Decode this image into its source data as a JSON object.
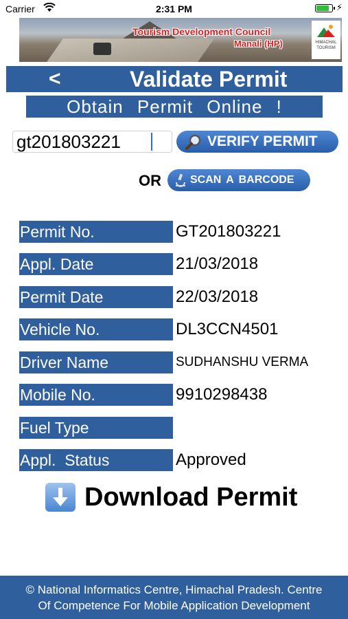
{
  "status_bar": {
    "carrier": "Carrier",
    "time": "2:31 PM",
    "battery_level": 0.85
  },
  "banner": {
    "title_line1": "Tourism Development Council",
    "title_line2": "Manali (HP)",
    "logo_text": "HIMACHAL TOURISM"
  },
  "header": {
    "back_label": "<",
    "title": "Validate Permit"
  },
  "subheader": "Obtain Permit Online !",
  "search": {
    "permit_value": "gt201803221",
    "verify_label": "VERIFY PERMIT",
    "or_label": "OR",
    "scan_label": "SCAN A BARCODE"
  },
  "details": {
    "permit_no": {
      "label": "Permit No.",
      "value": "GT201803221"
    },
    "appl_date": {
      "label": "Appl. Date",
      "value": "21/03/2018"
    },
    "permit_date": {
      "label": "Permit Date",
      "value": "22/03/2018"
    },
    "vehicle_no": {
      "label": "Vehicle No.",
      "value": "DL3CCN4501"
    },
    "driver_name": {
      "label": "Driver Name",
      "value": "SUDHANSHU VERMA"
    },
    "mobile_no": {
      "label": "Mobile No.",
      "value": "9910298438"
    },
    "fuel_type": {
      "label": "Fuel Type",
      "value": ""
    },
    "appl_status": {
      "label": "Appl.  Status",
      "value": "Approved"
    }
  },
  "download": {
    "label": "Download Permit"
  },
  "footer": {
    "line1": "© National Informatics Centre, Himachal Pradesh. Centre",
    "line2": "Of Competence For Mobile Application Development"
  },
  "colors": {
    "primary_blue": "#2f5f9c",
    "banner_text_red": "#d92020",
    "button_blue": "#3a72bf"
  },
  "icons": [
    "wifi-icon",
    "battery-icon",
    "charging-icon",
    "magnifier-icon",
    "microscope-icon",
    "download-arrow-icon"
  ]
}
